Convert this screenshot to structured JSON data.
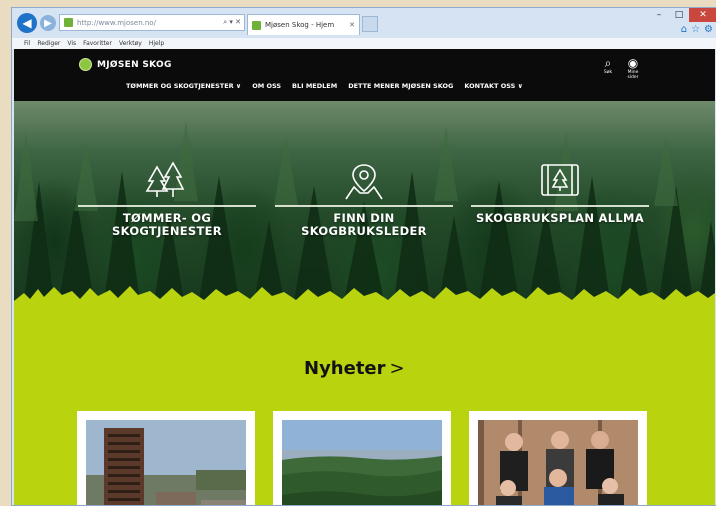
{
  "browser": {
    "address_text": "http://www.mjosen.no/",
    "tab_title": "Mjøsen Skog - Hjem",
    "menu": [
      "Fil",
      "Rediger",
      "Vis",
      "Favoritter",
      "Verktøy",
      "Hjelp"
    ],
    "back_icon": "back-arrow-icon",
    "forward_icon": "forward-arrow-icon"
  },
  "site": {
    "brand": "MJØSEN SKOG",
    "brand_color": "#8dc63f",
    "accent_color": "#b9d30f",
    "nav": [
      "TØMMER OG SKOGTJENESTER ∨",
      "OM OSS",
      "BLI MEDLEM",
      "DETTE MENER MJØSEN SKOG",
      "KONTAKT OSS ∨"
    ],
    "search_label": "Søk",
    "account_label": "Mine sider"
  },
  "hero": {
    "ctas": [
      {
        "label": "TØMMER- OG SKOGTJENESTER",
        "icon": "trees-icon"
      },
      {
        "label": "FINN DIN SKOGBRUKSLEDER",
        "icon": "map-pin-icon"
      },
      {
        "label": "SKOGBRUKSPLAN ALLMA",
        "icon": "tablet-tree-icon"
      }
    ]
  },
  "news": {
    "heading": "Nyheter",
    "chevron": ">",
    "cards": [
      {
        "image": "tower-building-photo"
      },
      {
        "image": "forest-landscape-photo"
      },
      {
        "image": "group-people-photo"
      }
    ]
  }
}
